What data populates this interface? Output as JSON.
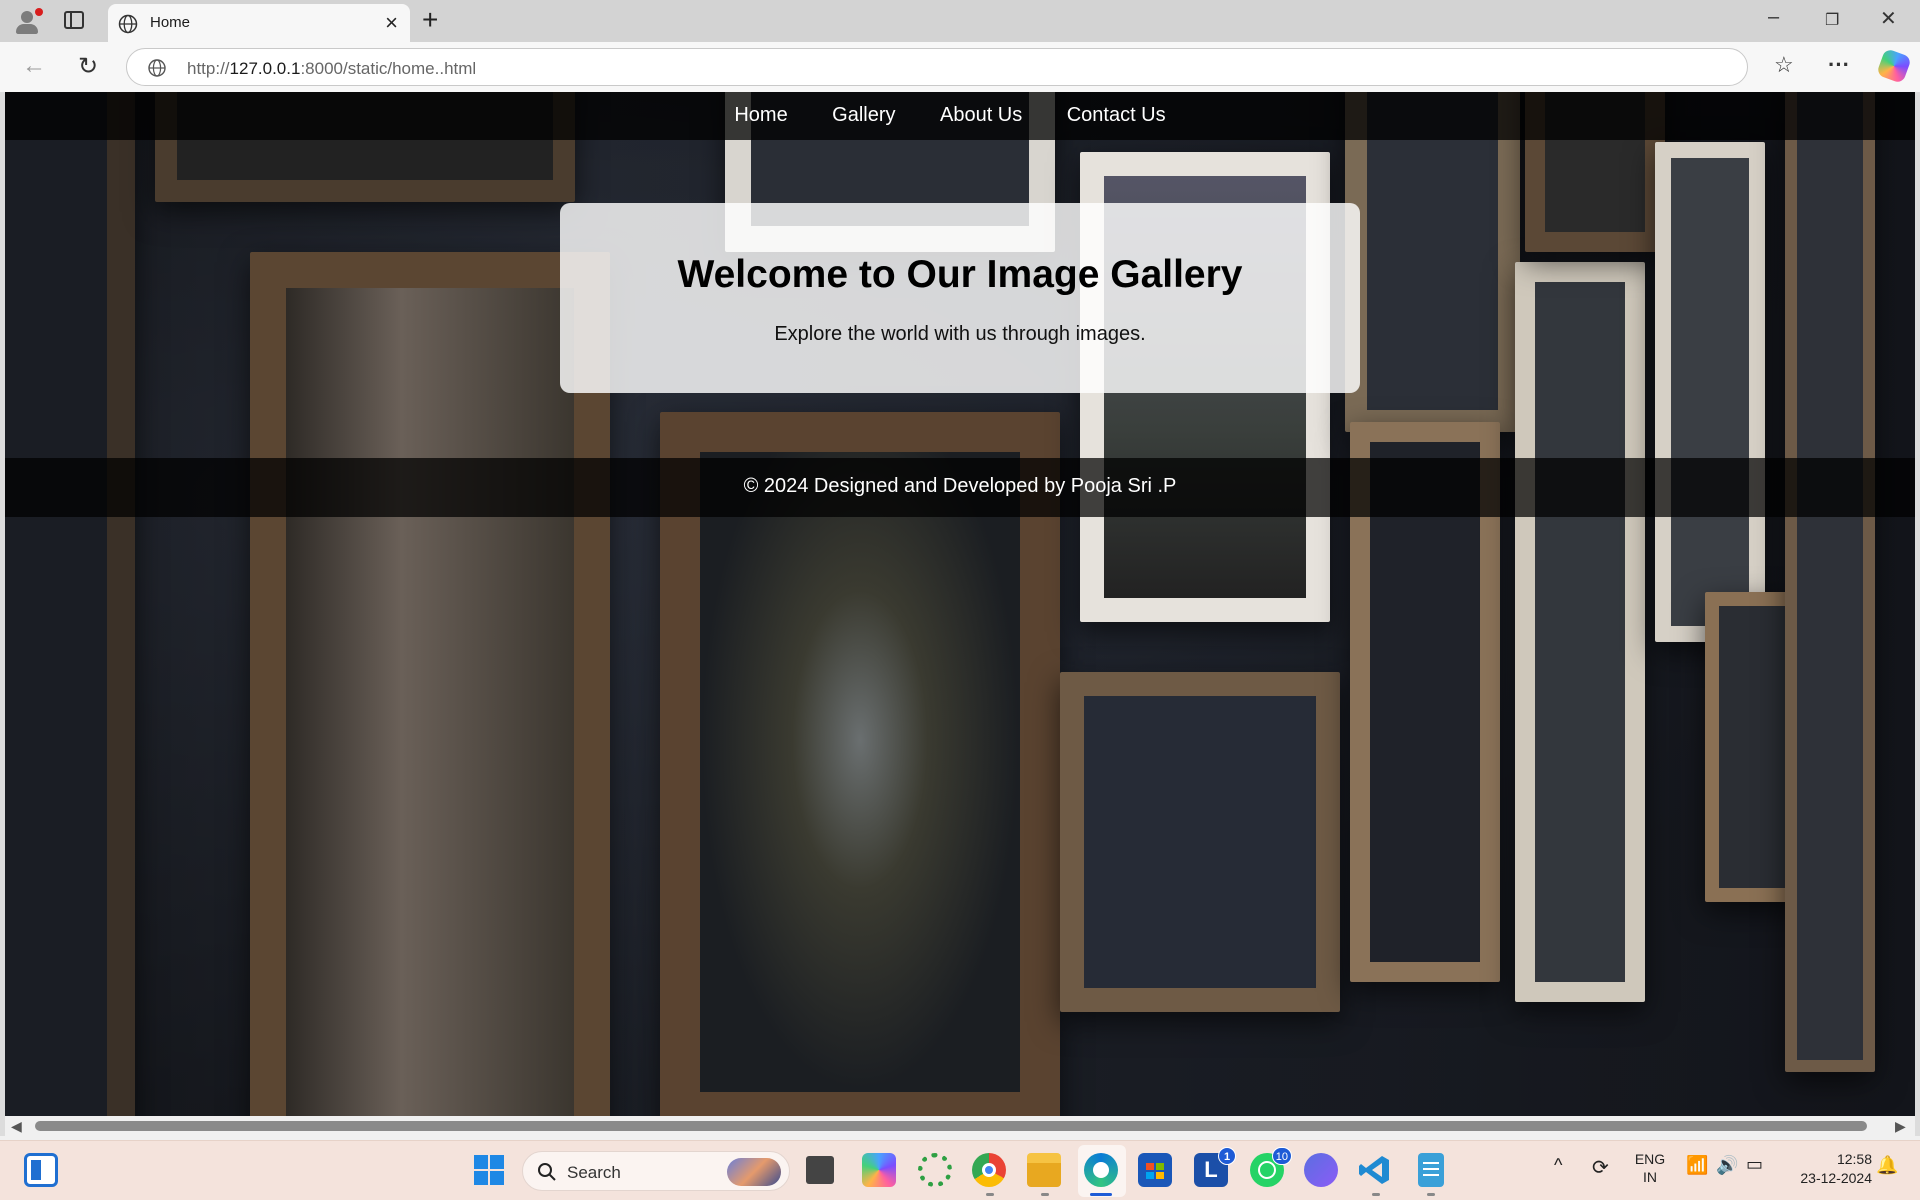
{
  "browser": {
    "tab_title": "Home",
    "url_prefix": "http://",
    "url_host": "127.0.0.1",
    "url_rest": ":8000/static/home..html"
  },
  "page": {
    "nav": [
      "Home",
      "Gallery",
      "About Us",
      "Contact Us"
    ],
    "hero_title": "Welcome to Our Image Gallery",
    "hero_subtitle": "Explore the world with us through images.",
    "footer_text": "© 2024 Designed and Developed by Pooja Sri .P"
  },
  "taskbar": {
    "search_placeholder": "Search",
    "badges": {
      "outlook_l": "1",
      "whatsapp": "10"
    },
    "lang_top": "ENG",
    "lang_bottom": "IN",
    "time": "12:58",
    "date": "23-12-2024"
  },
  "colors": {
    "accent": "#1e5bd6",
    "navbar_bg": "#000000",
    "hero_bg": "#ffffff"
  }
}
